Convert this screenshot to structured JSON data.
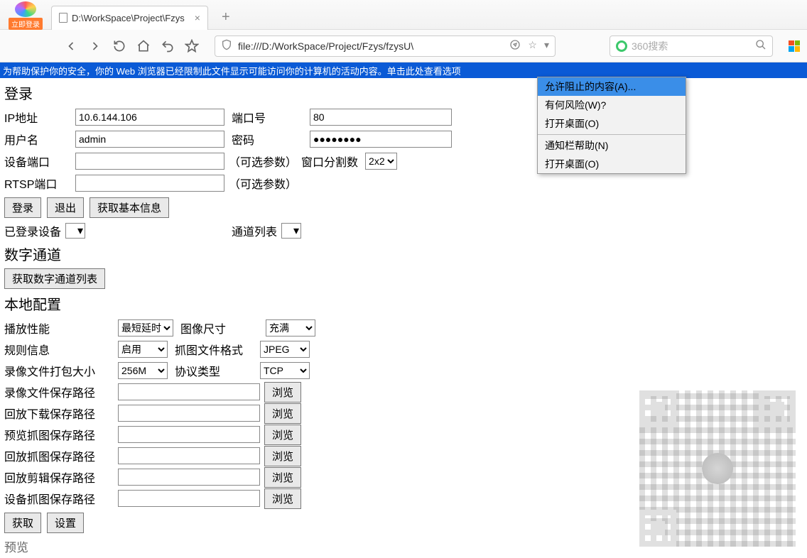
{
  "chrome": {
    "login_now": "立即登录",
    "tab_title": "D:\\WorkSpace\\Project\\Fzys",
    "address": "file:///D:/WorkSpace/Project/Fzys/fzysU\\",
    "search_placeholder": "360搜索"
  },
  "security_bar": "为帮助保护你的安全，你的 Web 浏览器已经限制此文件显示可能访问你的计算机的活动内容。单击此处查看选项",
  "context_menu": {
    "allow_blocked": "允许阻止的内容(A)...",
    "risk": "有何风险(W)?",
    "open_desktop1": "打开桌面(O)",
    "notify_help": "通知栏帮助(N)",
    "open_desktop2": "打开桌面(O)"
  },
  "login": {
    "heading": "登录",
    "ip_label": "IP地址",
    "ip_value": "10.6.144.106",
    "port_label": "端口号",
    "port_value": "80",
    "user_label": "用户名",
    "user_value": "admin",
    "pwd_label": "密码",
    "pwd_value": "●●●●●●●●",
    "devport_label": "设备端口",
    "devport_value": "",
    "optional": "（可选参数）",
    "split_label": "窗口分割数",
    "split_value": "2x2",
    "rtsp_label": "RTSP端口",
    "rtsp_value": "",
    "btn_login": "登录",
    "btn_logout": "退出",
    "btn_getinfo": "获取基本信息",
    "logged_label": "已登录设备",
    "channel_list_label": "通道列表"
  },
  "digital": {
    "heading": "数字通道",
    "btn_getlist": "获取数字通道列表"
  },
  "local": {
    "heading": "本地配置",
    "play_perf": "播放性能",
    "play_perf_val": "最短延时",
    "img_size": "图像尺寸",
    "img_size_val": "充满",
    "rule_info": "规则信息",
    "rule_info_val": "启用",
    "cap_fmt": "抓图文件格式",
    "cap_fmt_val": "JPEG",
    "rec_size": "录像文件打包大小",
    "rec_size_val": "256M",
    "proto": "协议类型",
    "proto_val": "TCP",
    "paths": {
      "rec": "录像文件保存路径",
      "playback_dl": "回放下载保存路径",
      "preview_cap": "预览抓图保存路径",
      "playback_cap": "回放抓图保存路径",
      "playback_clip": "回放剪辑保存路径",
      "device_cap": "设备抓图保存路径"
    },
    "browse": "浏览",
    "btn_get": "获取",
    "btn_set": "设置"
  },
  "footer_cut": "预览"
}
